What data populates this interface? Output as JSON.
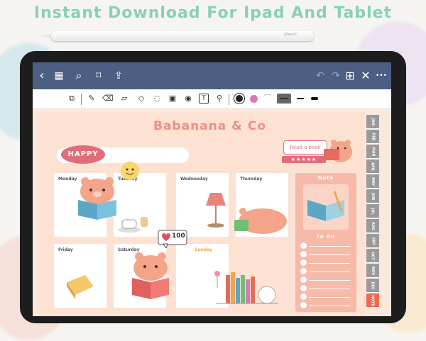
{
  "headline": "Instant Download For Ipad And Tablet",
  "pencil": {
    "brand": "Pencil"
  },
  "nav": {
    "left_icons": [
      "back-chevron-icon",
      "grid-icon",
      "search-icon",
      "bookmark-icon",
      "share-icon"
    ],
    "left_glyphs": [
      "‹",
      "▦",
      "⌕",
      "⌑",
      "⇪"
    ],
    "right_icons": [
      "undo-icon",
      "redo-icon",
      "add-page-icon",
      "close-icon",
      "more-icon"
    ],
    "right_glyphs": [
      "↶",
      "↷",
      "⊞",
      "✕",
      "•••"
    ]
  },
  "toolbar": {
    "tools": [
      "layers-icon",
      "pen-icon",
      "eraser-icon",
      "highlighter-icon",
      "shapes-icon",
      "lasso-icon",
      "image-icon",
      "camera-icon",
      "text-icon",
      "magic-wand-icon"
    ],
    "glyphs": [
      "⧉",
      "✎",
      "⌫",
      "▱",
      "◇",
      "◌",
      "▣",
      "◉",
      "T",
      "⚲"
    ],
    "colors": [
      "#222222",
      "#d978b4"
    ],
    "stroke_colors": [
      "#555555",
      "#222222",
      "#222222"
    ]
  },
  "planner": {
    "title": "Babanana & Co",
    "happy": "HAPPY",
    "read_label": "Read a book",
    "stars": "★★★★★",
    "days": [
      "Monday",
      "Tuesday",
      "Wednesday",
      "Thursday",
      "Friday",
      "Saturday",
      "Sunday"
    ],
    "note_title": "Note",
    "todo_title": "to do",
    "likes": "100"
  },
  "months": [
    "JAN",
    "FEB",
    "MAR",
    "APR",
    "MAY",
    "JUN",
    "JUL",
    "AUG",
    "SEP",
    "OCT",
    "NOV",
    "DEC",
    "NOTE"
  ],
  "colors": {
    "navbar": "#4c5f82",
    "page": "#fde2d3",
    "accent": "#ef8f84",
    "tab": "#9a9a9a",
    "note_tab": "#f2674f",
    "side": "#f7b9a8"
  }
}
